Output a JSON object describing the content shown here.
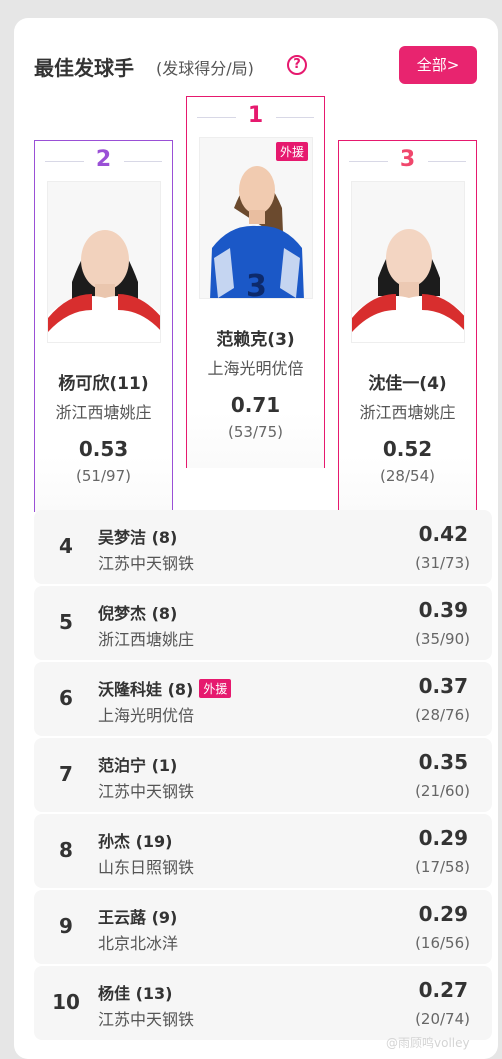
{
  "header": {
    "title": "最佳发球手",
    "subtitle": "(发球得分/局)",
    "help_glyph": "?",
    "all_button": "全部>"
  },
  "foreign_label": "外援",
  "podium": [
    {
      "rank": "2",
      "name": "杨可欣(11)",
      "team": "浙江西塘姚庄",
      "value": "0.53",
      "fraction": "(51/97)",
      "foreign": false
    },
    {
      "rank": "1",
      "name": "范赖克(3)",
      "team": "上海光明优倍",
      "value": "0.71",
      "fraction": "(53/75)",
      "foreign": true
    },
    {
      "rank": "3",
      "name": "沈佳一(4)",
      "team": "浙江西塘姚庄",
      "value": "0.52",
      "fraction": "(28/54)",
      "foreign": false
    }
  ],
  "list": [
    {
      "rank": "4",
      "name": "吴梦洁 (8)",
      "team": "江苏中天钢铁",
      "value": "0.42",
      "fraction": "(31/73)",
      "foreign": false
    },
    {
      "rank": "5",
      "name": "倪梦杰 (8)",
      "team": "浙江西塘姚庄",
      "value": "0.39",
      "fraction": "(35/90)",
      "foreign": false
    },
    {
      "rank": "6",
      "name": "沃隆科娃 (8)",
      "team": "上海光明优倍",
      "value": "0.37",
      "fraction": "(28/76)",
      "foreign": true
    },
    {
      "rank": "7",
      "name": "范泊宁 (1)",
      "team": "江苏中天钢铁",
      "value": "0.35",
      "fraction": "(21/60)",
      "foreign": false
    },
    {
      "rank": "8",
      "name": "孙杰 (19)",
      "team": "山东日照钢铁",
      "value": "0.29",
      "fraction": "(17/58)",
      "foreign": false
    },
    {
      "rank": "9",
      "name": "王云蕗 (9)",
      "team": "北京北冰洋",
      "value": "0.29",
      "fraction": "(16/56)",
      "foreign": false
    },
    {
      "rank": "10",
      "name": "杨佳 (13)",
      "team": "江苏中天钢铁",
      "value": "0.27",
      "fraction": "(20/74)",
      "foreign": false
    }
  ],
  "watermark": "@雨顾鸣volley",
  "colors": {
    "accent": "#e8246f",
    "rank2": "#9a50d6",
    "rank3": "#f0476c"
  }
}
